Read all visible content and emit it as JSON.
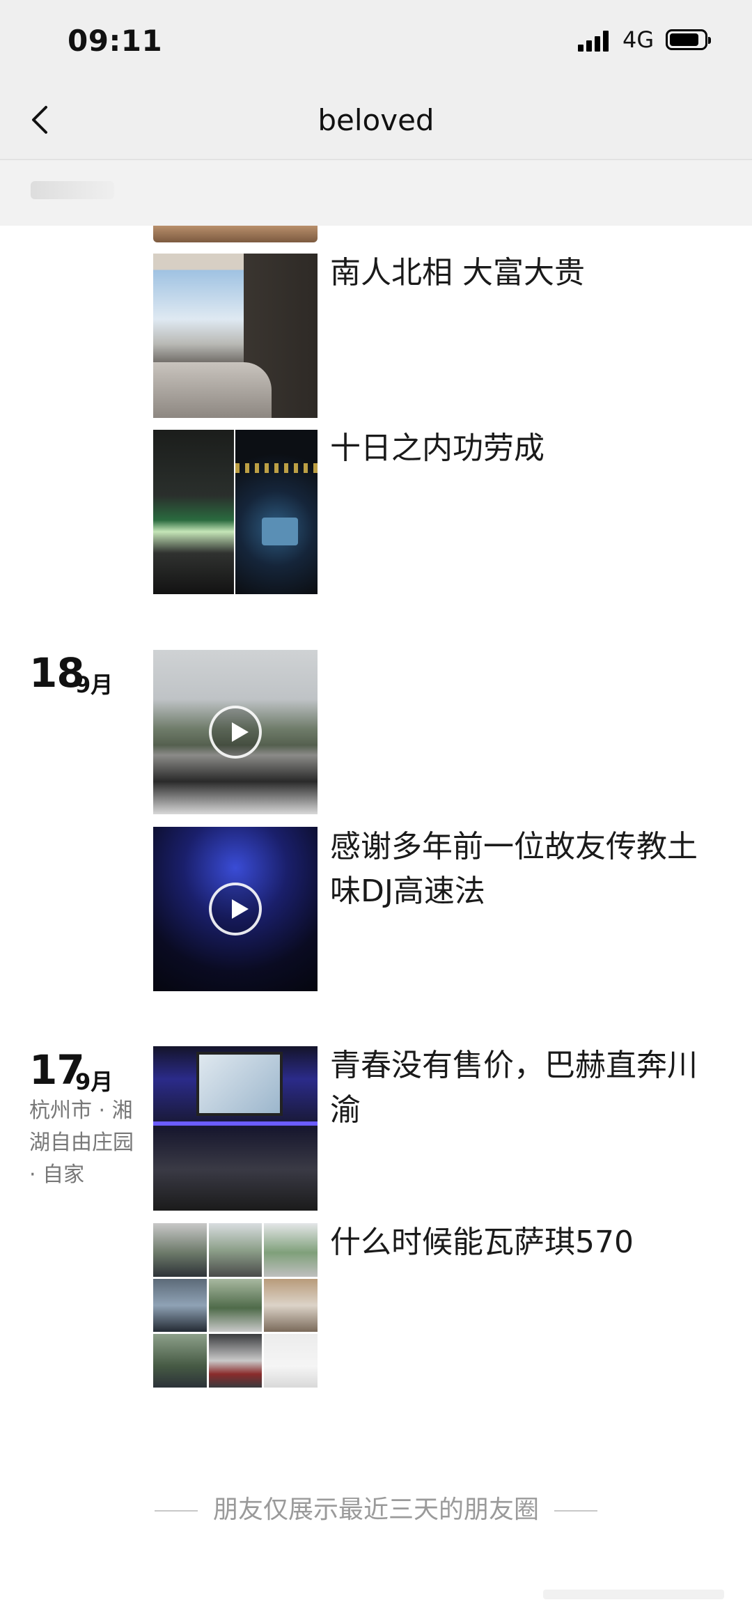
{
  "status": {
    "time": "09:11",
    "network": "4G",
    "battery_level": 0.85
  },
  "nav": {
    "title": "beloved"
  },
  "posts": [
    {
      "caption": "南人北相 大富大贵"
    },
    {
      "caption": "十日之内功劳成"
    },
    {
      "day": "18",
      "month": "9月",
      "caption": ""
    },
    {
      "caption": "感谢多年前一位故友传教土味DJ高速法"
    },
    {
      "day": "17",
      "month": "9月",
      "location": "杭州市 · 湘湖自由庄园 · 自家",
      "caption": "青春没有售价，巴赫直奔川渝"
    },
    {
      "caption": "什么时候能瓦萨琪570"
    }
  ],
  "footer": {
    "text": "朋友仅展示最近三天的朋友圈"
  }
}
